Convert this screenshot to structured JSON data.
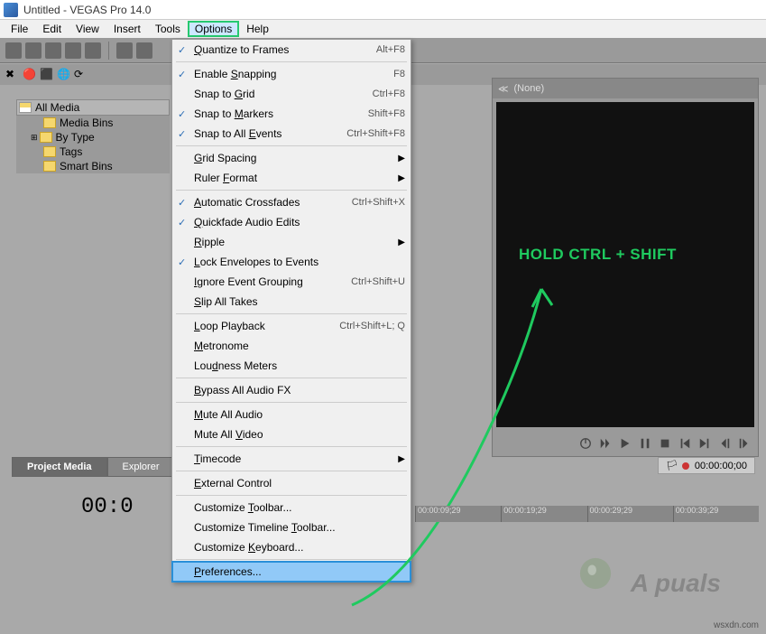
{
  "title": "Untitled - VEGAS Pro 14.0",
  "menubar": [
    "File",
    "Edit",
    "View",
    "Insert",
    "Tools",
    "Options",
    "Help"
  ],
  "menubar_highlighted": "Options",
  "media_tree": {
    "root": "All Media",
    "items": [
      "Media Bins",
      "By Type",
      "Tags",
      "Smart Bins"
    ]
  },
  "tabs": {
    "items": [
      "Project Media",
      "Explorer"
    ],
    "active": 0
  },
  "dropdown": {
    "items": [
      {
        "label": "Quantize to Frames",
        "u": 0,
        "shortcut": "Alt+F8",
        "checked": true
      },
      {
        "sep": true
      },
      {
        "label": "Enable Snapping",
        "u": 7,
        "shortcut": "F8",
        "checked": true
      },
      {
        "label": "Snap to Grid",
        "u": 8,
        "shortcut": "Ctrl+F8",
        "checked": false
      },
      {
        "label": "Snap to Markers",
        "u": 8,
        "shortcut": "Shift+F8",
        "checked": true
      },
      {
        "label": "Snap to All Events",
        "u": 12,
        "shortcut": "Ctrl+Shift+F8",
        "checked": true
      },
      {
        "sep": true
      },
      {
        "label": "Grid Spacing",
        "u": 0,
        "submenu": true
      },
      {
        "label": "Ruler Format",
        "u": 6,
        "submenu": true
      },
      {
        "sep": true
      },
      {
        "label": "Automatic Crossfades",
        "u": 0,
        "shortcut": "Ctrl+Shift+X",
        "checked": true
      },
      {
        "label": "Quickfade Audio Edits",
        "u": 0,
        "checked": true
      },
      {
        "label": "Ripple",
        "u": 0,
        "submenu": true
      },
      {
        "label": "Lock Envelopes to Events",
        "u": 0,
        "checked": true
      },
      {
        "label": "Ignore Event Grouping",
        "u": 0,
        "shortcut": "Ctrl+Shift+U"
      },
      {
        "label": "Slip All Takes",
        "u": 0
      },
      {
        "sep": true
      },
      {
        "label": "Loop Playback",
        "u": 0,
        "shortcut": "Ctrl+Shift+L; Q"
      },
      {
        "label": "Metronome",
        "u": 0
      },
      {
        "label": "Loudness Meters",
        "u": 3
      },
      {
        "sep": true
      },
      {
        "label": "Bypass All Audio FX",
        "u": 0
      },
      {
        "sep": true
      },
      {
        "label": "Mute All Audio",
        "u": 0
      },
      {
        "label": "Mute All Video",
        "u": 9
      },
      {
        "sep": true
      },
      {
        "label": "Timecode",
        "u": 0,
        "submenu": true
      },
      {
        "sep": true
      },
      {
        "label": "External Control",
        "u": 0
      },
      {
        "sep": true
      },
      {
        "label": "Customize Toolbar...",
        "u": 10
      },
      {
        "label": "Customize Timeline Toolbar...",
        "u": 19
      },
      {
        "label": "Customize Keyboard...",
        "u": 10
      },
      {
        "sep": true
      },
      {
        "label": "Preferences...",
        "u": 0,
        "highlighted": true
      }
    ]
  },
  "preview": {
    "header": "(None)"
  },
  "annotation": "HOLD CTRL + SHIFT",
  "timecode": "00:00:00;00",
  "time_display": "00:0",
  "ruler_ticks": [
    "00:00:09;29",
    "00:00:19;29",
    "00:00:29;29",
    "00:00:39;29"
  ],
  "watermark": "A puals",
  "watermark_url": "wsxdn.com"
}
